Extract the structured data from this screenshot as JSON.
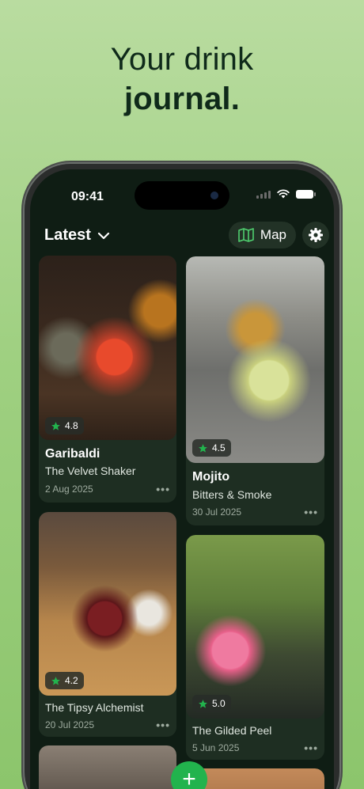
{
  "headline": {
    "line1": "Your drink",
    "line2": "journal."
  },
  "status": {
    "time": "09:41"
  },
  "header": {
    "title": "Latest",
    "map_label": "Map"
  },
  "cards": [
    {
      "title": "Garibaldi",
      "venue": "The Velvet Shaker",
      "date": "2 Aug 2025",
      "rating": "4.8"
    },
    {
      "title": "Mojito",
      "venue": "Bitters & Smoke",
      "date": "30 Jul 2025",
      "rating": "4.5"
    },
    {
      "title": "",
      "venue": "The Tipsy Alchemist",
      "date": "20 Jul 2025",
      "rating": "4.2"
    },
    {
      "title": "",
      "venue": "The Gilded Peel",
      "date": "5 Jun 2025",
      "rating": "5.0"
    }
  ],
  "more_label": "•••",
  "fab_label": "+",
  "colors": {
    "accent": "#22b34d",
    "background": "#0f1d14",
    "card": "#1e2e22"
  },
  "icons": [
    "chevron-down-icon",
    "map-icon",
    "gear-icon",
    "star-icon",
    "more-icon",
    "plus-icon",
    "wifi-icon",
    "battery-icon",
    "signal-icon"
  ]
}
